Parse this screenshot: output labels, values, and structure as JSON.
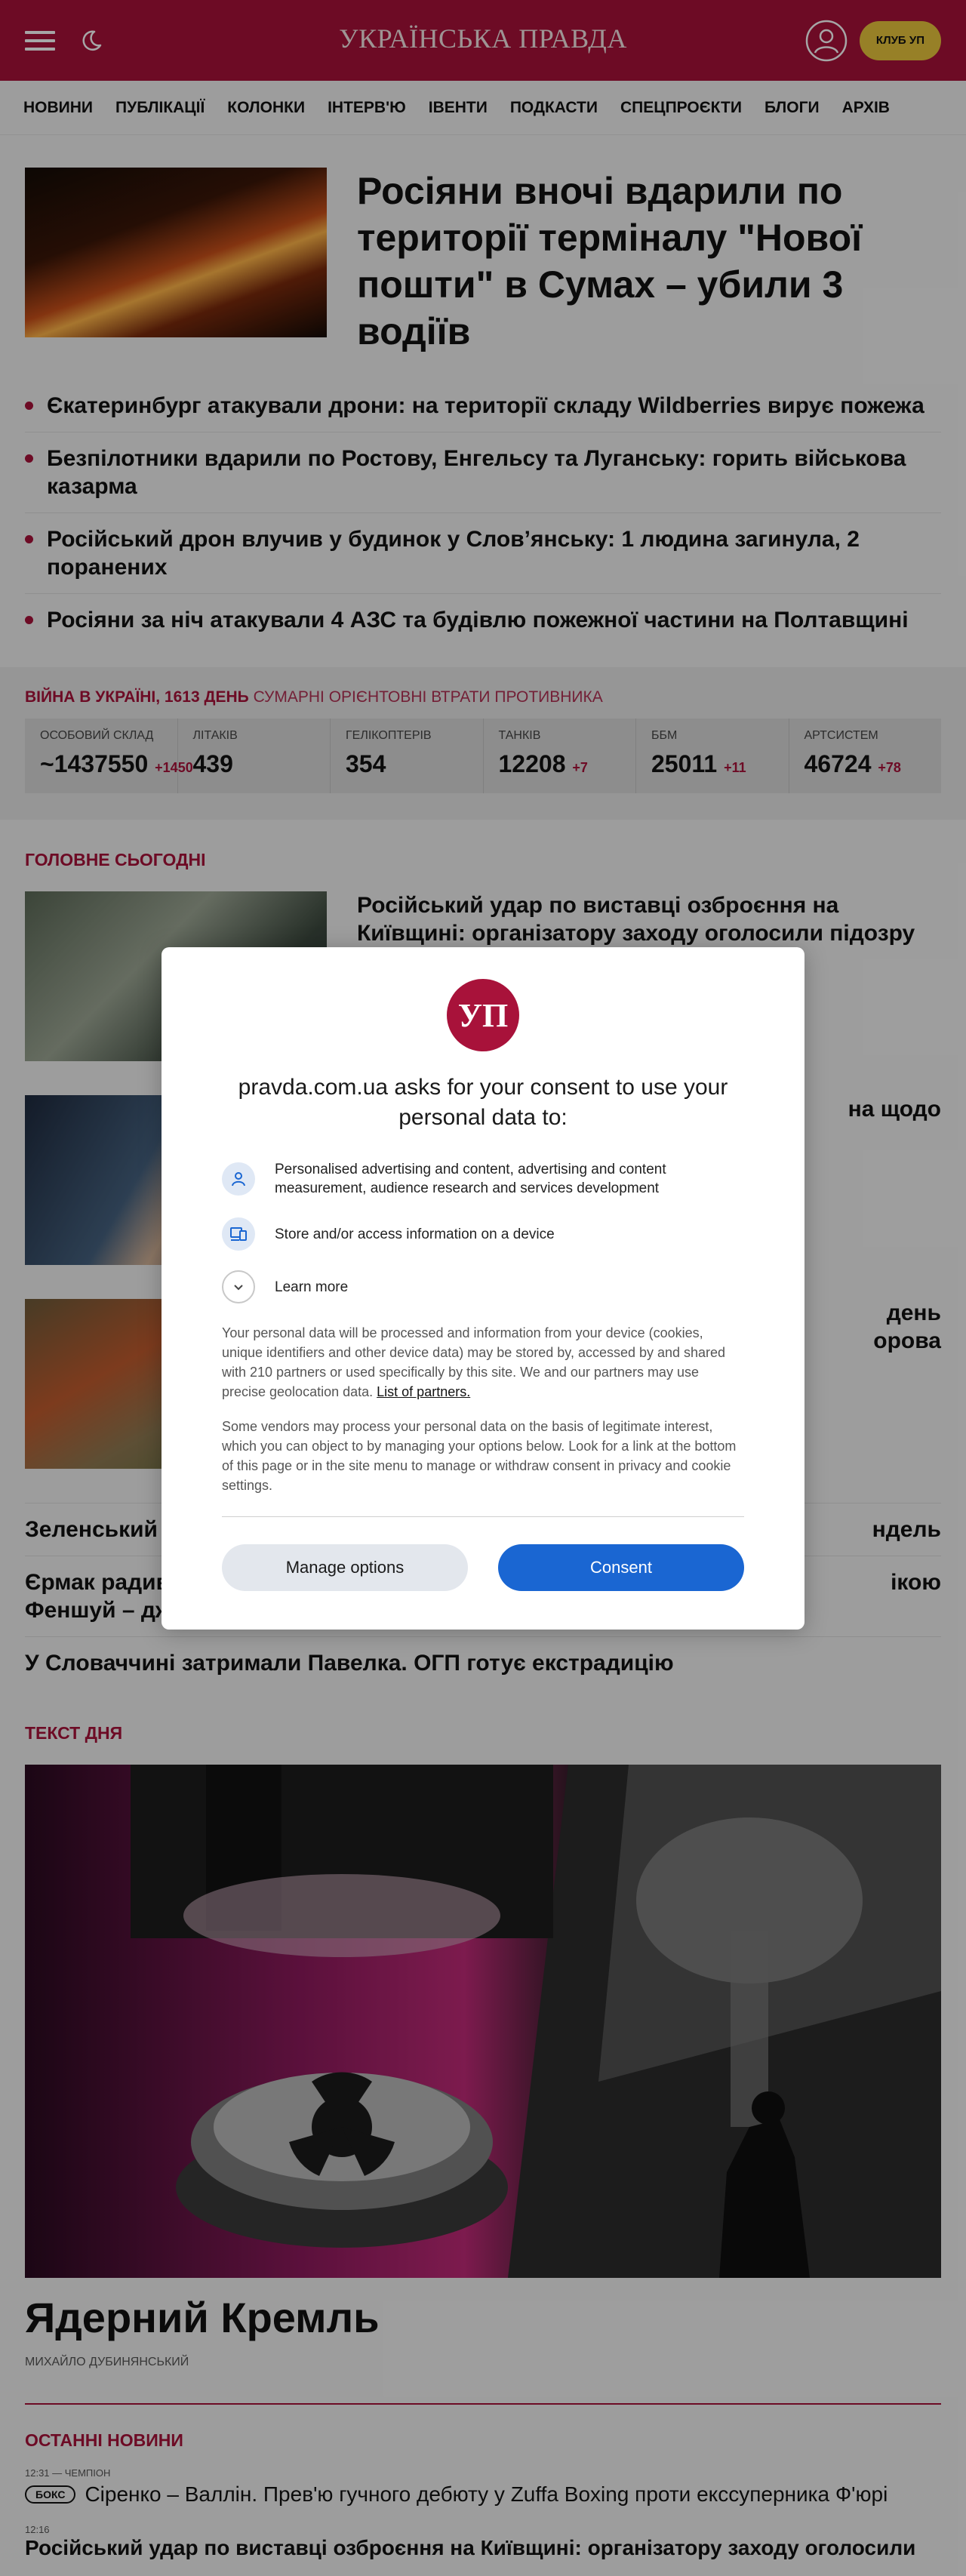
{
  "header": {
    "logo": "УКРАЇНСЬКА ПРАВДА",
    "club_label": "КЛУБ УП"
  },
  "nav": {
    "items": [
      "Новини",
      "Публікації",
      "Колонки",
      "Інтерв'ю",
      "Івенти",
      "Подкасти",
      "Спецпроєкти",
      "Блоги",
      "Архів"
    ]
  },
  "hero": {
    "title": "Росіяни вночі вдарили по території терміналу \"Нової пошти\" в Сумах – убили 3 водіїв"
  },
  "bullets": [
    "Єкатеринбург атакували дрони: на території складу Wildberries вирує пожежа",
    "Безпілотники вдарили по Ростову, Енгельсу та Луганську: горить військова казарма",
    "Російський дрон влучив у будинок у Слов’янську: 1 людина загинула, 2 поранених",
    "Росіяни за ніч атакували 4 АЗС та будівлю пожежної частини на Полтавщині"
  ],
  "war": {
    "title_red": "ВІЙНА В УКРАЇНІ, 1613 ДЕНЬ",
    "title_muted": "СУМАРНІ ОРІЄНТОВНІ ВТРАТИ ПРОТИВНИКА",
    "stats": [
      {
        "label": "Особовий склад",
        "value": "~1437550",
        "delta": "+1450"
      },
      {
        "label": "Літаків",
        "value": "439",
        "delta": ""
      },
      {
        "label": "Гелікоптерів",
        "value": "354",
        "delta": ""
      },
      {
        "label": "Танків",
        "value": "12208",
        "delta": "+7"
      },
      {
        "label": "ББМ",
        "value": "25011",
        "delta": "+11"
      },
      {
        "label": "Артсистем",
        "value": "46724",
        "delta": "+78"
      }
    ]
  },
  "today": {
    "title": "ГОЛОВНЕ СЬОГОДНІ",
    "cards": [
      {
        "title": "Російський удар по виставці озброєння на Київщині: організатору заходу оголосили підозру"
      },
      {
        "title": "на щодо"
      },
      {
        "title": "день орова"
      }
    ],
    "links": [
      {
        "left": "Зеленський з",
        "right": "ндель"
      },
      {
        "left": "Єрмак радив",
        "right": "ікою",
        "line2": "Феншуй – дж"
      },
      {
        "left": "У Словаччині затримали Павелка. ОГП готує екстрадицію",
        "right": ""
      }
    ]
  },
  "text_of_day": {
    "section": "ТЕКСТ ДНЯ",
    "title": "Ядерний Кремль",
    "author": "МИХАЙЛО ДУБИНЯНСЬКИЙ"
  },
  "latest": {
    "section": "ОСТАННІ НОВИНИ",
    "items": [
      {
        "meta": "12:31 — ЧЕМПІОН",
        "tag": "БОКС",
        "title": "Сіренко – Валлін. Прев'ю гучного дебюту у Zuffa Boxing проти екссуперника Ф'юрі"
      },
      {
        "meta": "12:16",
        "tag": "",
        "title": "Російський удар по виставці озброєння на Київщині: організатору заходу оголосили"
      }
    ]
  },
  "consent": {
    "logo_text": "УП",
    "title": "pravda.com.ua asks for your consent to use your personal data to:",
    "purposes": [
      {
        "icon": "person-icon",
        "text": "Personalised advertising and content, advertising and content measurement, audience research and services development"
      },
      {
        "icon": "device-icon",
        "text": "Store and/or access information on a device"
      }
    ],
    "learn_more": "Learn more",
    "para1": "Your personal data will be processed and information from your device (cookies, unique identifiers and other device data) may be stored by, accessed by and shared with 210 partners or used specifically by this site. We and our partners may use precise geolocation data.",
    "partners_link": "List of partners.",
    "para2": "Some vendors may process your personal data on the basis of legitimate interest, which you can object to by managing your options below. Look for a link at the bottom of this page or in the site menu to manage or withdraw consent in privacy and cookie settings.",
    "manage_label": "Manage options",
    "consent_label": "Consent"
  },
  "colors": {
    "brand": "#a8123a",
    "accent_yellow": "#e9c53d",
    "consent_button": "#1a66d2"
  }
}
